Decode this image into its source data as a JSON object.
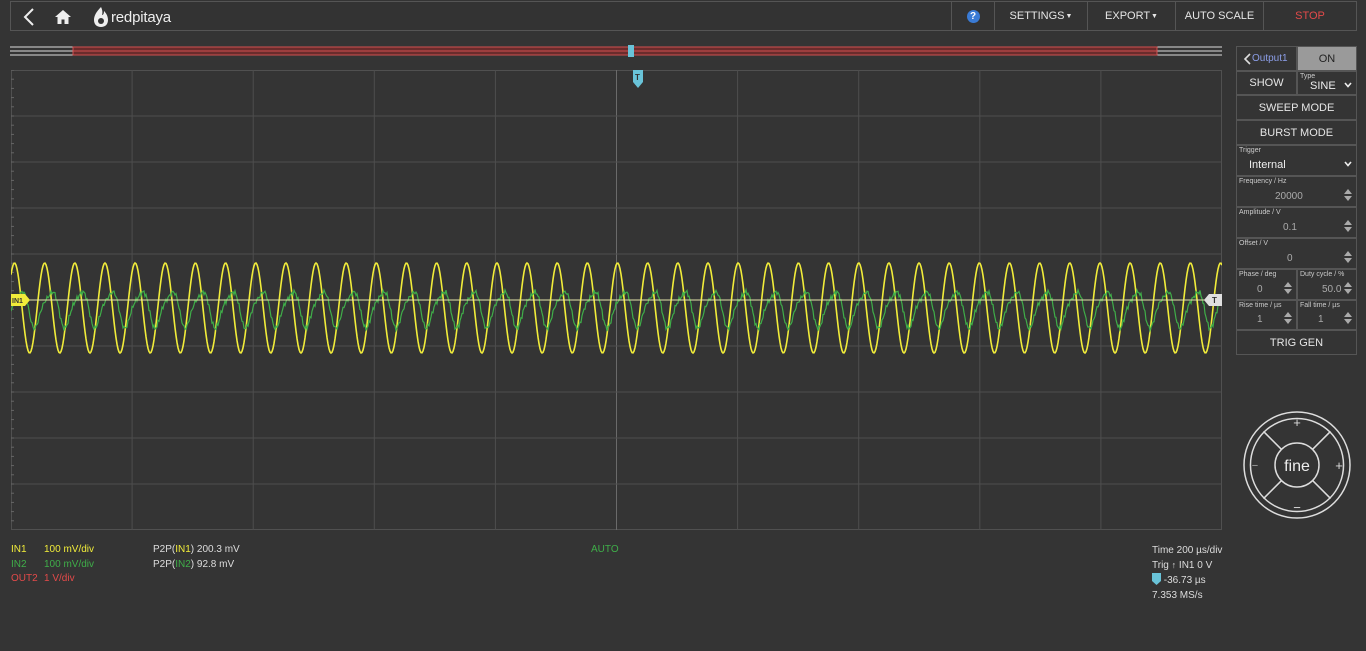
{
  "topbar": {
    "logo_text": "redpitaya",
    "menu": {
      "help": "?",
      "settings": "SETTINGS",
      "export": "EXPORT",
      "auto_scale": "AUTO SCALE",
      "stop": "STOP"
    }
  },
  "trigger_marker": "T",
  "channels": [
    {
      "name": "IN1",
      "scale": "100 mV/div",
      "color": "#f1ec3a"
    },
    {
      "name": "IN2",
      "scale": "100 mV/div",
      "color": "#3fae49"
    },
    {
      "name": "OUT2",
      "scale": "1 V/div",
      "color": "#e34a4a"
    }
  ],
  "measurements": [
    {
      "prefix": "P2P(",
      "channel": "IN1",
      "suffix": ") 200.3 mV"
    },
    {
      "prefix": "P2P(",
      "channel": "IN2",
      "suffix": ") 92.8 mV"
    }
  ],
  "trigger_state": "AUTO",
  "status": {
    "time": "Time 200 µs/div",
    "trig_prefix": "Trig ",
    "trig_source": "IN1 0 V",
    "trig_delay": "-36.73 µs",
    "sample_rate": "7.353 MS/s"
  },
  "marker_labels": {
    "in1": "IN1",
    "trig": "T"
  },
  "generator": {
    "output": "Output1",
    "on_label": "ON",
    "show_label": "SHOW",
    "type_label": "Type",
    "type_value": "SINE",
    "sweep_mode": "SWEEP MODE",
    "burst_mode": "BURST MODE",
    "trigger_label": "Trigger",
    "trigger_value": "Internal",
    "frequency_label": "Frequency / Hz",
    "frequency_value": "20000",
    "amplitude_label": "Amplitude / V",
    "amplitude_value": "0.1",
    "offset_label": "Offset / V",
    "offset_value": "0",
    "phase_label": "Phase / deg",
    "phase_value": "0",
    "duty_label": "Duty cycle / %",
    "duty_value": "50.0",
    "rise_label": "Rise time / µs",
    "rise_value": "1",
    "fall_label": "Fall time / µs",
    "fall_value": "1",
    "trig_gen": "TRIG GEN"
  },
  "jog": {
    "center": "fine",
    "plus": "+",
    "minus": "−"
  },
  "colors": {
    "in1": "#f1ec3a",
    "in2": "#3fae49",
    "out2": "#e34a4a",
    "marker": "#69c3d8"
  }
}
